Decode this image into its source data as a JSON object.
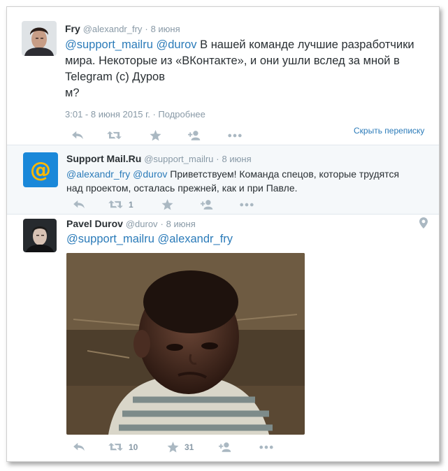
{
  "tweets": [
    {
      "name": "Fry",
      "handle": "@alexandr_fry",
      "separator": "·",
      "date": "8 июня",
      "text": {
        "mention1": "@support_mailru",
        "mention2": "@durov",
        "line1_rest": " В нашей команде лучшие разработчики",
        "line2": "мира. Некоторые из «ВКонтакте», и они ушли вслед за мной в",
        "line3": "Telegram (с) Дуров",
        "line4": "м?"
      },
      "timestamp": "3:01 - 8 июня 2015 г.",
      "details_link": "Подробнее",
      "hide_conversation": "Скрыть переписку"
    },
    {
      "name": "Support Mail.Ru",
      "handle": "@support_mailru",
      "separator": "·",
      "date": "8 июня",
      "avatar_glyph": "@",
      "text": {
        "mention1": "@alexandr_fry",
        "mention2": "@durov",
        "line1_rest": " Приветствуем! Команда спецов, которые трудятся",
        "line2": "над проектом, осталась прежней, как и при Павле."
      },
      "retweets": "1"
    },
    {
      "name": "Pavel Durov",
      "handle": "@durov",
      "separator": "·",
      "date": "8 июня",
      "text": {
        "mention1": "@support_mailru",
        "mention2": "@alexandr_fry"
      },
      "retweets": "10",
      "likes": "31"
    }
  ],
  "colors": {
    "link": "#2b7bb9",
    "muted": "#8899a6",
    "icon": "#aab8c2",
    "reply_bg": "#f5f8fa"
  },
  "icons": [
    "reply-icon",
    "retweet-icon",
    "favorite-icon",
    "follow-icon",
    "more-icon",
    "location-pin-icon"
  ]
}
